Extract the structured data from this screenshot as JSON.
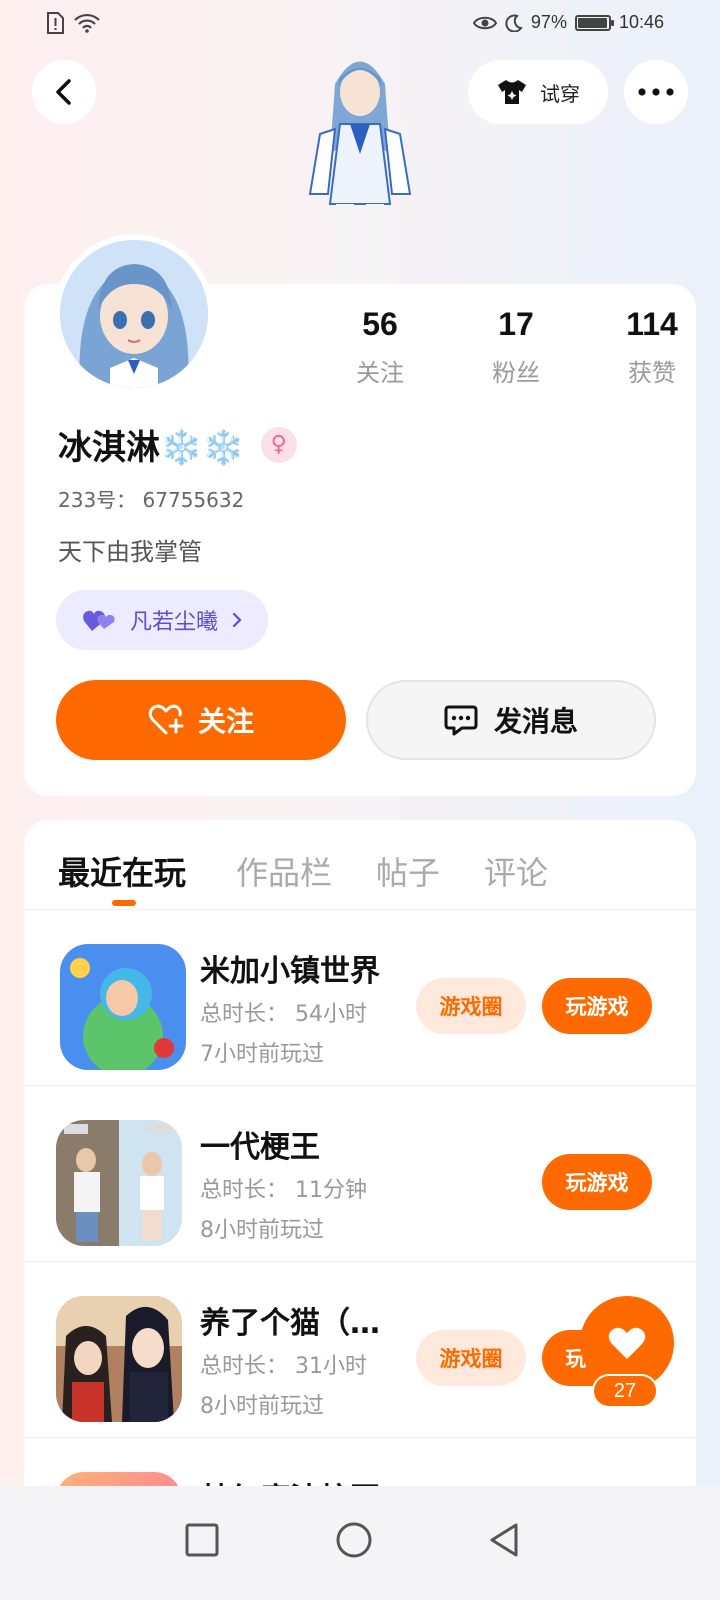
{
  "status_bar": {
    "battery_percent": "97%",
    "battery_level": 0.97,
    "time": "10:46"
  },
  "top": {
    "try_on_label": "试穿"
  },
  "profile": {
    "name": "冰淇淋❄️❄️",
    "gender_symbol": "♀",
    "stats": [
      {
        "value": "56",
        "label": "关注"
      },
      {
        "value": "17",
        "label": "粉丝"
      },
      {
        "value": "114",
        "label": "获赞"
      }
    ],
    "uid": "233号：  67755632",
    "bio": "天下由我掌管",
    "group_name": "凡若尘曦",
    "follow_label": "关注",
    "message_label": "发消息"
  },
  "tabs": [
    {
      "label": "最近在玩",
      "active": true
    },
    {
      "label": "作品栏",
      "active": false
    },
    {
      "label": "帖子",
      "active": false
    },
    {
      "label": "评论",
      "active": false
    }
  ],
  "games": [
    {
      "name": "米加小镇世界",
      "duration": "总时长：  54小时",
      "last_played": "7小时前玩过",
      "circle_label": "游戏圈",
      "play_label": "玩游戏"
    },
    {
      "name": "一代梗王",
      "duration": "总时长：  11分钟",
      "last_played": "8小时前玩过",
      "circle_label": "",
      "play_label": "玩游戏"
    },
    {
      "name": "养了个猫（…",
      "duration": "总时长：  31小时",
      "last_played": "8小时前玩过",
      "circle_label": "游戏圈",
      "play_label": "玩游戏"
    },
    {
      "name": "梦幻魔法校园",
      "duration": "",
      "last_played": "",
      "circle_label": "",
      "play_label": ""
    }
  ],
  "like_float": {
    "count": "27"
  }
}
